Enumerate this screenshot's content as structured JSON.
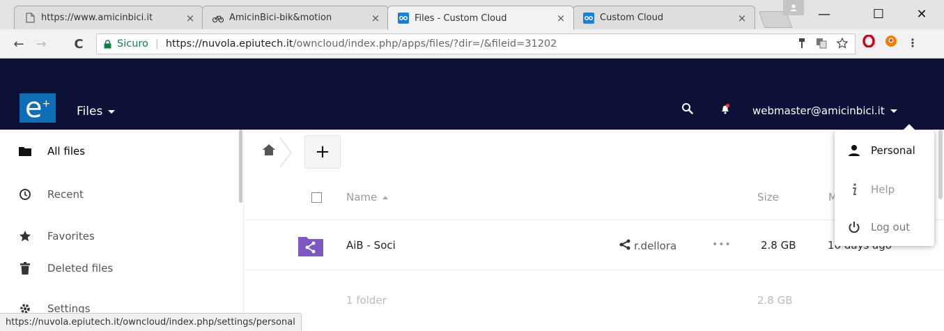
{
  "browser": {
    "tabs": [
      {
        "title": "https://www.amicinbici.it",
        "icon": "page-icon",
        "close": "×"
      },
      {
        "title": "AmicinBici-bik&motion",
        "icon": "bike-icon",
        "close": "×"
      },
      {
        "title": "Files - Custom Cloud",
        "icon": "cloud-icon",
        "close": "×"
      },
      {
        "title": "Custom Cloud",
        "icon": "cloud-icon",
        "close": "×"
      }
    ],
    "window_controls": {
      "minimize": "—",
      "maximize": "☐",
      "close": "✕"
    },
    "nav": {
      "back": "←",
      "forward": "→",
      "reload": "C"
    },
    "address": {
      "secure_label": "Sicuro",
      "host": "https://nuvola.epiutech.it",
      "path": "/owncloud/index.php/apps/files/?dir=/&fileid=31202"
    },
    "status_url": "https://nuvola.epiutech.it/owncloud/index.php/settings/personal"
  },
  "app": {
    "logo_letter": "e",
    "logo_sup": "+",
    "menu_label": "Files",
    "user_email": "webmaster@amicinbici.it",
    "colors": {
      "header": "#0d1137",
      "logo": "#0f6db5",
      "folder": "#7e57c2"
    }
  },
  "sidebar": {
    "items": [
      {
        "label": "All files",
        "icon": "folder-icon"
      },
      {
        "label": "Recent",
        "icon": "clock-icon"
      },
      {
        "label": "Favorites",
        "icon": "star-icon"
      },
      {
        "label": "Deleted files",
        "icon": "trash-icon"
      },
      {
        "label": "Settings",
        "icon": "gear-icon"
      }
    ]
  },
  "files": {
    "new_button": "+",
    "columns": {
      "name": "Name",
      "size": "Size",
      "modified": "M"
    },
    "rows": [
      {
        "name": "AiB - Soci",
        "shared_with": "r.dellora",
        "more": "•••",
        "size": "2.8 GB",
        "modified": "10 days ago"
      }
    ],
    "summary": {
      "count": "1 folder",
      "size": "2.8 GB"
    }
  },
  "user_menu": {
    "items": [
      {
        "label": "Personal",
        "icon": "person-icon"
      },
      {
        "label": "Help",
        "icon": "info-icon"
      },
      {
        "label": "Log out",
        "icon": "power-icon"
      }
    ]
  }
}
